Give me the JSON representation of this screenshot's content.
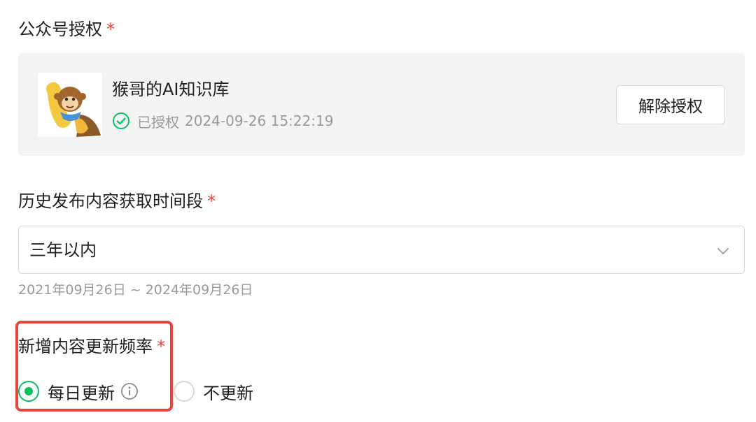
{
  "authorization": {
    "label": "公众号授权",
    "required_mark": "*",
    "account_name": "猴哥的AI知识库",
    "status_text": "已授权",
    "authorized_time": "2024-09-26 15:22:19",
    "revoke_label": "解除授权"
  },
  "history": {
    "label": "历史发布内容获取时间段",
    "required_mark": "*",
    "selected_value": "三年以内",
    "range_hint": "2021年09月26日 ~ 2024年09月26日"
  },
  "update_frequency": {
    "label": "新增内容更新频率",
    "required_mark": "*",
    "options": [
      {
        "label": "每日更新",
        "checked": true
      },
      {
        "label": "不更新",
        "checked": false
      }
    ]
  },
  "colors": {
    "accent_green": "#07c160",
    "required_red": "#e8453c",
    "highlight_red": "#e8453c"
  }
}
